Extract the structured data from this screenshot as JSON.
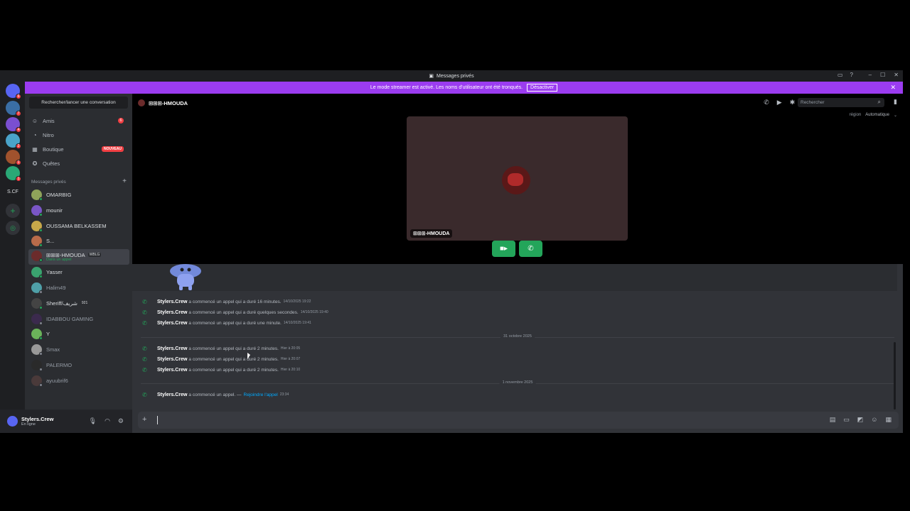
{
  "window": {
    "title": "Messages privés",
    "controls": [
      "–",
      "☐",
      "✕"
    ]
  },
  "banner": {
    "text": "Le mode streamer est activé. Les noms d'utilisateur ont été tronqués.",
    "button": "Désactiver"
  },
  "servers": [
    {
      "color": "#5865f2",
      "badge": "6",
      "icon": "discord-home-icon"
    },
    {
      "color": "#3a6ea5",
      "badge": "7"
    },
    {
      "color": "#7a4fd1",
      "badge": "4"
    },
    {
      "color": "#4aa3c9",
      "badge": "2"
    },
    {
      "color": "#a0522d",
      "badge": "1"
    },
    {
      "color": "#2aa876",
      "badge": "1"
    }
  ],
  "servers_extra": {
    "folder_label": "S.CF"
  },
  "sidebar": {
    "search_placeholder": "Rechercher/lancer une conversation",
    "nav": [
      {
        "label": "Amis",
        "icon": "friends-icon",
        "badge": "6"
      },
      {
        "label": "Nitro",
        "icon": "nitro-icon"
      },
      {
        "label": "Boutique",
        "icon": "shop-icon",
        "tag": "NOUVEAU"
      },
      {
        "label": "Quêtes",
        "icon": "quests-icon"
      }
    ],
    "dm_header": "Messages privés",
    "dms": [
      {
        "name": "OMARBIG",
        "color": "#8fa35a",
        "status": "online"
      },
      {
        "name": "mounir",
        "color": "#7a56c7",
        "status": "online"
      },
      {
        "name": "OUSSAMA BELKASSEM",
        "color": "#c7a84a",
        "status": "online"
      },
      {
        "name": "S...",
        "color": "#b96b4a",
        "status": "online"
      },
      {
        "name": "⊞⊞⊞-HMOUDA",
        "color": "#6b2b2b",
        "status": "online",
        "sub": "Dans un appel",
        "tag": "WBLG"
      },
      {
        "name": "Yasser",
        "color": "#3aa36f",
        "status": "online"
      },
      {
        "name": "Halim49",
        "color": "#4fa0a8",
        "status": "offline"
      },
      {
        "name": "Sheriff/شريف",
        "color": "#444",
        "status": "online",
        "tag": "921"
      },
      {
        "name": "IDABBOU GAMING",
        "color": "#3b2a4d",
        "status": "offline"
      },
      {
        "name": "Y",
        "color": "#6bb35a",
        "status": "online"
      },
      {
        "name": "Smax",
        "color": "#999",
        "status": "offline"
      },
      {
        "name": "PALERMO",
        "color": "#2a2a2a",
        "status": "offline"
      },
      {
        "name": "ayuubrif6",
        "color": "#4a3a3a",
        "status": "offline"
      }
    ]
  },
  "user": {
    "name": "Stylers.Crew",
    "status": "En ligne"
  },
  "channel": {
    "name": "⊞⊞⊞-HMOUDA",
    "search_placeholder": "Rechercher",
    "region_label": "région",
    "region_value": "Automatique"
  },
  "call": {
    "participant": "⊞⊞⊞-HMOUDA"
  },
  "messages": [
    {
      "who": "Stylers.Crew",
      "text": "a commencé un appel qui a duré 16 minutes.",
      "time": "14/10/2025 19:22"
    },
    {
      "who": "Stylers.Crew",
      "text": "a commencé un appel qui a duré quelques secondes.",
      "time": "14/10/2025 19:40"
    },
    {
      "who": "Stylers.Crew",
      "text": "a commencé un appel qui a duré une minute.",
      "time": "14/10/2025 19:41"
    },
    {
      "who": "Stylers.Crew",
      "text": "a commencé un appel qui a duré 2 minutes.",
      "time": "Hier à 20:05"
    },
    {
      "who": "Stylers.Crew",
      "text": "a commencé un appel qui a duré 2 minutes.",
      "time": "Hier à 20:07"
    },
    {
      "who": "Stylers.Crew",
      "text": "a commencé un appel qui a duré 2 minutes.",
      "time": "Hier à 20:10"
    },
    {
      "who": "Stylers.Crew",
      "text": "a commencé un appel. —",
      "join": "Rejoindre l'appel",
      "time": "23:34"
    }
  ],
  "dividers": [
    "31 octobre 2025",
    "1 novembre 2025"
  ]
}
